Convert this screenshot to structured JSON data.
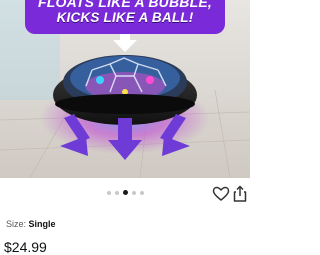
{
  "banner": {
    "line1": "FLOATS LIKE A BUBBLE,",
    "line2": "KICKS LIKE A BALL!"
  },
  "gallery": {
    "dot_count": 5,
    "active_index": 2
  },
  "product": {
    "size_label": "Size: ",
    "size_value": "Single",
    "price": "$24.99"
  },
  "icons": {
    "favorite": "heart-icon",
    "share": "share-icon",
    "arrow_down": "arrow-down-icon",
    "arrows_up": "arrows-up-icon"
  },
  "colors": {
    "banner_purple": "#7a2ad8",
    "arrow_purple": "#6f3bd6",
    "floor": "#d9d4ce"
  }
}
